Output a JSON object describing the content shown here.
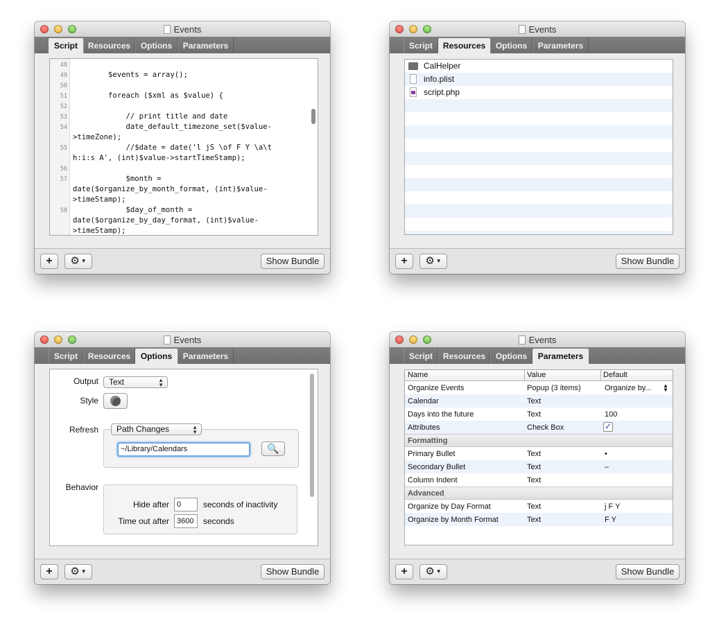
{
  "window_title": "Events",
  "tabs": [
    "Script",
    "Resources",
    "Options",
    "Parameters"
  ],
  "bottom": {
    "add_label": "+",
    "gear_label": "⚙",
    "show_bundle_label": "Show Bundle"
  },
  "script": {
    "lines": [
      {
        "num": "48",
        "code": ""
      },
      {
        "num": "49",
        "code": "        $events = array();"
      },
      {
        "num": "50",
        "code": ""
      },
      {
        "num": "51",
        "code": "        foreach ($xml as $value) {"
      },
      {
        "num": "52",
        "code": ""
      },
      {
        "num": "53",
        "code": "            // print title and date"
      },
      {
        "num": "54",
        "code": "            date_default_timezone_set($value-"
      },
      {
        "num": "",
        "code": ">timeZone);"
      },
      {
        "num": "55",
        "code": "            //$date = date('l jS \\of F Y \\a\\t"
      },
      {
        "num": "",
        "code": "h:i:s A', (int)$value->startTimeStamp);"
      },
      {
        "num": "56",
        "code": ""
      },
      {
        "num": "57",
        "code": "            $month ="
      },
      {
        "num": "",
        "code": "date($organize_by_month_format, (int)$value-"
      },
      {
        "num": "",
        "code": ">timeStamp);"
      },
      {
        "num": "58",
        "code": "            $day_of_month ="
      },
      {
        "num": "",
        "code": "date($organize_by_day_format, (int)$value-"
      },
      {
        "num": "",
        "code": ">timeStamp);"
      }
    ]
  },
  "resources": {
    "items": [
      {
        "name": "CalHelper",
        "icon": "folder-icon"
      },
      {
        "name": "info.plist",
        "icon": "file-icon"
      },
      {
        "name": "script.php",
        "icon": "php-file-icon"
      }
    ]
  },
  "options": {
    "output_label": "Output",
    "output_value": "Text",
    "style_label": "Style",
    "refresh_label": "Refresh",
    "refresh_value": "Path Changes",
    "path_value": "~/Library/Calendars",
    "behavior_label": "Behavior",
    "hide_after_label": "Hide after",
    "hide_after_value": "0",
    "hide_after_suffix": "seconds of inactivity",
    "timeout_label": "Time out after",
    "timeout_value": "3600",
    "timeout_suffix": "seconds"
  },
  "parameters": {
    "columns": [
      "Name",
      "Value",
      "Default"
    ],
    "rows": [
      {
        "type": "row",
        "name": "Organize Events",
        "value": "Popup (3 items)",
        "default": "Organize by..."
      },
      {
        "type": "row",
        "name": "Calendar",
        "value": "Text",
        "default": ""
      },
      {
        "type": "row",
        "name": "Days into the future",
        "value": "Text",
        "default": "100"
      },
      {
        "type": "row",
        "name": "Attributes",
        "value": "Check Box",
        "default": "✓"
      },
      {
        "type": "section",
        "name": "Formatting"
      },
      {
        "type": "row",
        "name": "Primary Bullet",
        "value": "Text",
        "default": "•"
      },
      {
        "type": "row",
        "name": "Secondary Bullet",
        "value": "Text",
        "default": "–"
      },
      {
        "type": "row",
        "name": "Column Indent",
        "value": "Text",
        "default": ""
      },
      {
        "type": "section",
        "name": "Advanced"
      },
      {
        "type": "row",
        "name": "Organize by Day Format",
        "value": "Text",
        "default": "j F Y"
      },
      {
        "type": "row",
        "name": "Organize by Month Format",
        "value": "Text",
        "default": "F Y"
      }
    ]
  }
}
